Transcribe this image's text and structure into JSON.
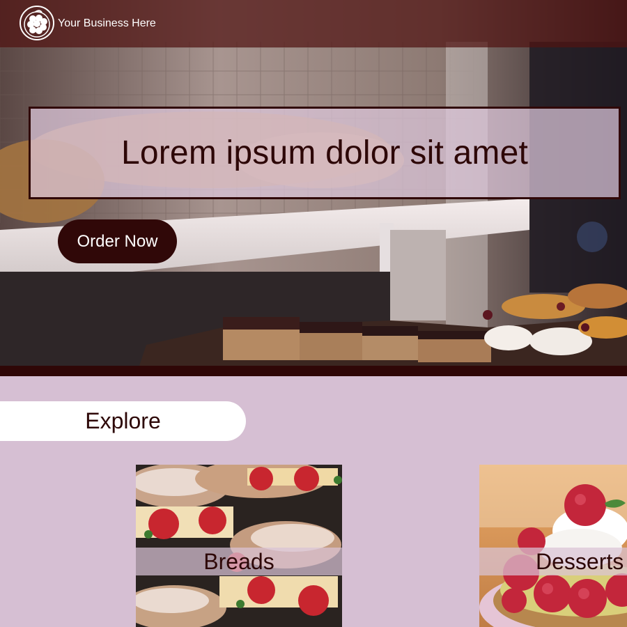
{
  "header": {
    "brand_name": "Your Business Here",
    "logo_icon": "raspberry-logo-icon"
  },
  "hero": {
    "headline": "Lorem ipsum dolor sit amet",
    "cta_label": "Order Now",
    "image": "bakery-display-case-photo"
  },
  "explore": {
    "title": "Explore",
    "cards": [
      {
        "label": "Breads",
        "image": "strawberry-croissants-photo"
      },
      {
        "label": "Desserts",
        "image": "raspberry-tart-photo"
      }
    ]
  },
  "colors": {
    "accent_dark": "#300808",
    "page_background": "#d6bfd3",
    "text_dark": "#2d0707",
    "header_overlay": "#50141266"
  }
}
